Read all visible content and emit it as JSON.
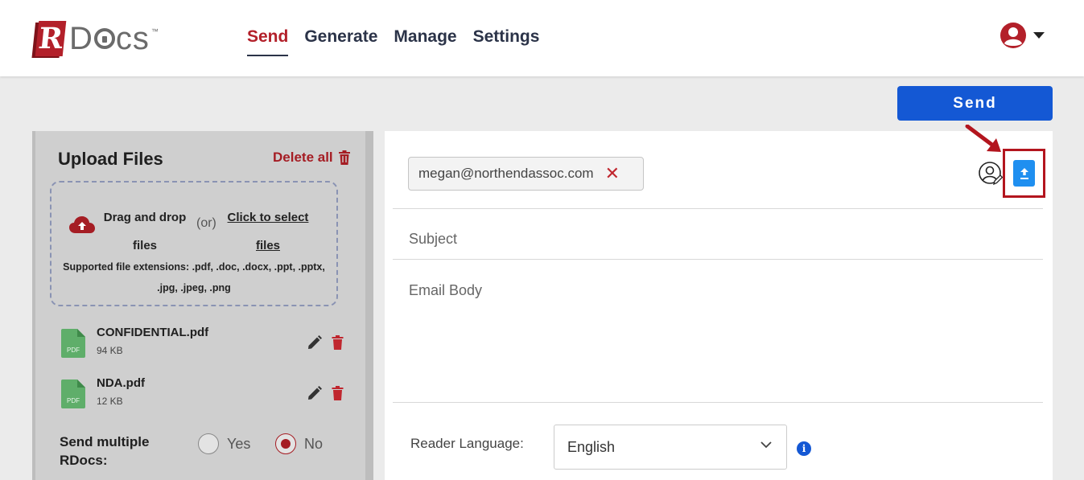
{
  "header": {
    "logo": {
      "r_letter": "R",
      "rest": "D",
      "rest2": "cs",
      "tm": "™"
    },
    "nav": [
      {
        "label": "Send",
        "active": true
      },
      {
        "label": "Generate",
        "active": false
      },
      {
        "label": "Manage",
        "active": false
      },
      {
        "label": "Settings",
        "active": false
      }
    ],
    "user_icon": "user-circle-icon"
  },
  "toolbar": {
    "send_label": "Send"
  },
  "upload": {
    "title": "Upload Files",
    "delete_all": "Delete all",
    "dropzone": {
      "drag_text": "Drag and drop files",
      "or_text": "(or)",
      "click_text": "Click to select files",
      "extensions": "Supported file extensions: .pdf, .doc, .docx, .ppt, .pptx, .jpg, .jpeg, .png"
    },
    "files": [
      {
        "name": "CONFIDENTIAL.pdf",
        "size": "94 KB",
        "type_label": "PDF"
      },
      {
        "name": "NDA.pdf",
        "size": "12 KB",
        "type_label": "PDF"
      }
    ],
    "multiple": {
      "label": "Send multiple RDocs:",
      "options": [
        {
          "label": "Yes",
          "selected": false
        },
        {
          "label": "No",
          "selected": true
        }
      ]
    }
  },
  "email": {
    "recipient": "megan@northendassoc.com",
    "remove_symbol": "✕",
    "subject_placeholder": "Subject",
    "body_placeholder": "Email Body",
    "reader_language_label": "Reader Language:",
    "reader_language_value": "English",
    "info_symbol": "i"
  },
  "colors": {
    "brand_red": "#b3202a",
    "primary_blue": "#1458d4",
    "upload_blue": "#1f8ff0",
    "file_green": "#5fae6a"
  }
}
